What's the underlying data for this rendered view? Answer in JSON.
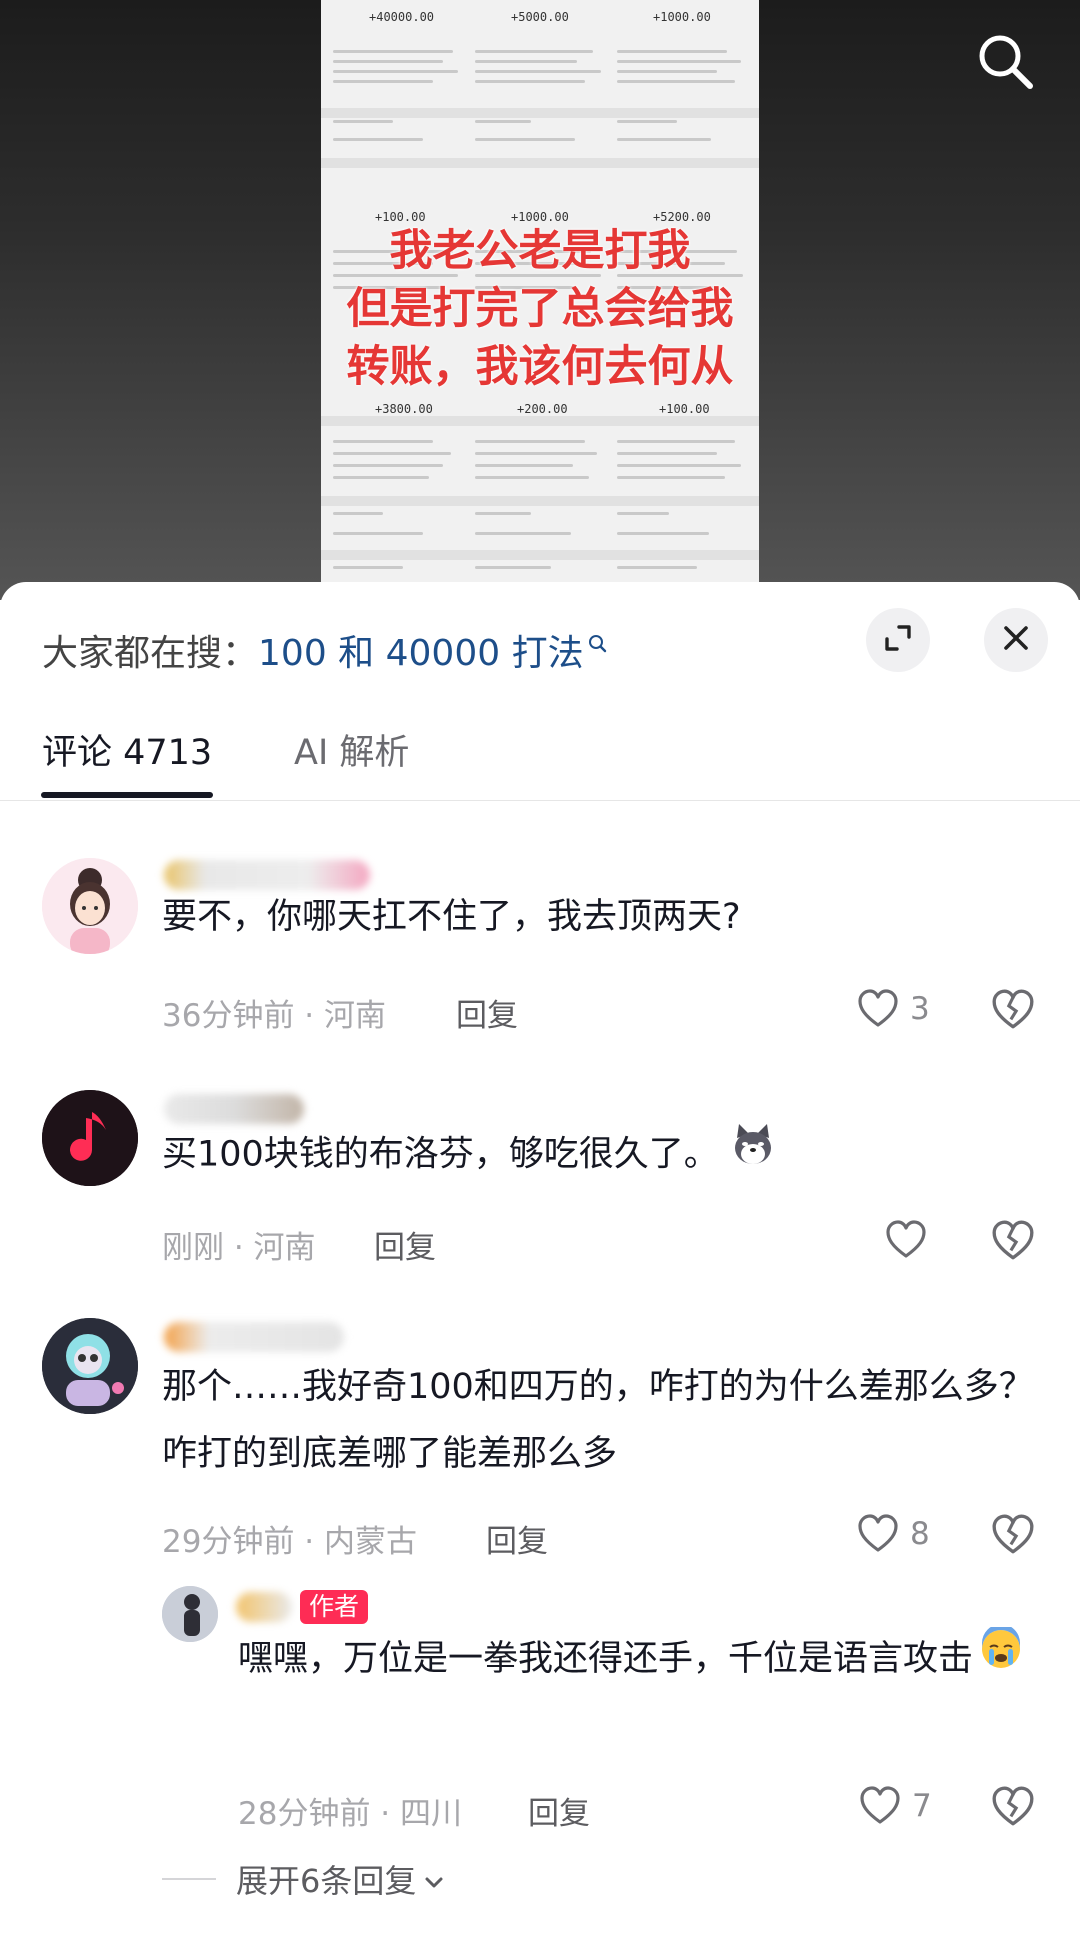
{
  "video": {
    "overlay_lines": [
      "我老公老是打我",
      "但是打完了总会给我",
      "转账，我该何去何从"
    ],
    "receipt_amounts": [
      "+40000.00",
      "+5000.00",
      "+1000.00",
      "+100.00",
      "+1000.00",
      "+5200.00",
      "+3800.00",
      "+200.00",
      "+100.00"
    ],
    "search_icon": "search-icon"
  },
  "search_hint": {
    "prefix": "大家都在搜：",
    "query": "100 和 40000 打法",
    "expand_icon": "expand-icon",
    "close_icon": "close-icon"
  },
  "tabs": [
    {
      "label": "评论 4713",
      "active": true
    },
    {
      "label": "AI 解析",
      "active": false
    }
  ],
  "comments": [
    {
      "text": "要不，你哪天扛不住了，我去顶两天?",
      "meta": "36分钟前 · 河南",
      "reply": "回复",
      "likes": "3"
    },
    {
      "text": "买100块钱的布洛芬，够吃很久了。",
      "meta": "刚刚 · 河南",
      "reply": "回复",
      "likes": ""
    },
    {
      "text": "那个……我好奇100和四万的，咋打的为什么差那么多？咋打的到底差哪了能差那么多",
      "meta": "29分钟前 · 内蒙古",
      "reply": "回复",
      "likes": "8"
    }
  ],
  "author_reply": {
    "badge": "作者",
    "text": "嘿嘿，万位是一拳我还得还手，千位是语言攻击",
    "meta": "28分钟前 · 四川",
    "reply": "回复",
    "likes": "7"
  },
  "expand_replies": "展开6条回复",
  "colors": {
    "accent": "#fe2c55",
    "query": "#1d4e89",
    "overlay": "#e53735"
  }
}
